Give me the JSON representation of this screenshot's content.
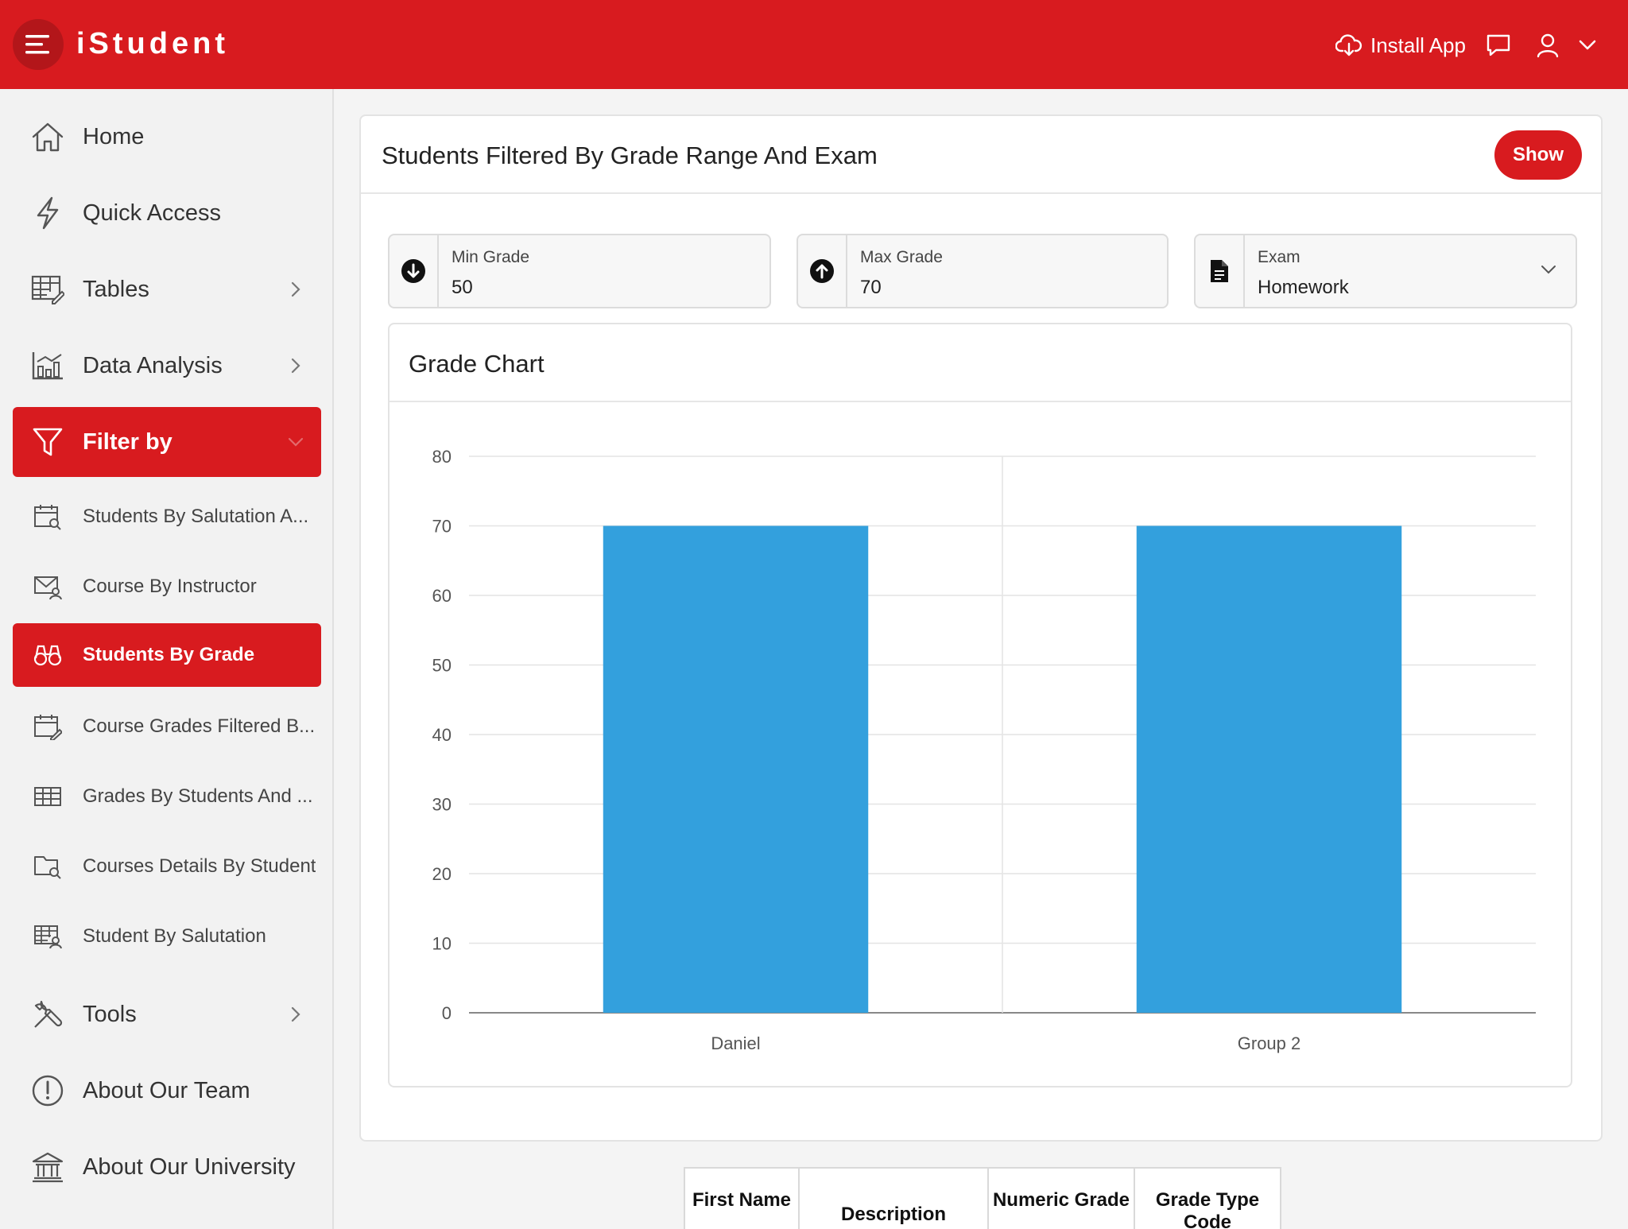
{
  "header": {
    "app_name": "iStudent",
    "install_label": "Install App"
  },
  "sidebar": {
    "items": [
      {
        "label": "Home",
        "icon": "home-icon"
      },
      {
        "label": "Quick Access",
        "icon": "lightning-icon"
      },
      {
        "label": "Tables",
        "icon": "table-edit-icon"
      },
      {
        "label": "Data Analysis",
        "icon": "bar-chart-icon"
      },
      {
        "label": "Filter by",
        "icon": "filter-icon"
      },
      {
        "label": "Students By Salutation A...",
        "icon": "calendar-search-icon"
      },
      {
        "label": "Course By Instructor",
        "icon": "mail-user-icon"
      },
      {
        "label": "Students By Grade",
        "icon": "binoculars-icon"
      },
      {
        "label": "Course Grades Filtered B...",
        "icon": "calendar-edit-icon"
      },
      {
        "label": "Grades By Students And ...",
        "icon": "grid-icon"
      },
      {
        "label": "Courses Details By Student",
        "icon": "folder-search-icon"
      },
      {
        "label": "Student By Salutation",
        "icon": "table-user-icon"
      },
      {
        "label": "Tools",
        "icon": "tools-icon"
      },
      {
        "label": "About Our Team",
        "icon": "info-circle-icon"
      },
      {
        "label": "About Our University",
        "icon": "university-icon"
      }
    ]
  },
  "main": {
    "title": "Students Filtered By Grade Range And Exam",
    "show_label": "Show",
    "filters": {
      "min_label": "Min Grade",
      "min_value": "50",
      "max_label": "Max Grade",
      "max_value": "70",
      "exam_label": "Exam",
      "exam_value": "Homework"
    },
    "chart_title": "Grade Chart"
  },
  "chart_data": {
    "type": "bar",
    "categories": [
      "Daniel",
      "Group 2"
    ],
    "values": [
      70,
      70
    ],
    "ylim": [
      0,
      80
    ],
    "yticks": [
      "0",
      "10",
      "20",
      "30",
      "40",
      "50",
      "60",
      "70",
      "80"
    ],
    "grid": true,
    "bar_color": "#33a0dd"
  },
  "table": {
    "headers": [
      "First Name",
      "Description",
      "Numeric Grade",
      "Grade Type Code"
    ]
  },
  "colors": {
    "accent": "#d81b1f"
  }
}
